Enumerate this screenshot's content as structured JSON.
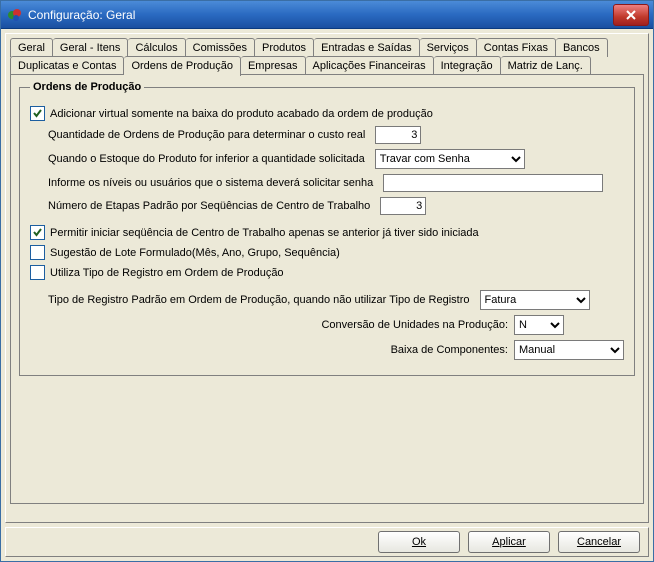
{
  "window": {
    "title": "Configuração: Geral"
  },
  "tabs": {
    "row1": [
      "Geral",
      "Geral - Itens",
      "Cálculos",
      "Comissões",
      "Produtos",
      "Entradas e Saídas",
      "Serviços",
      "Contas Fixas",
      "Bancos"
    ],
    "row2": [
      "Duplicatas e Contas",
      "Ordens de Produção",
      "Empresas",
      "Aplicações Financeiras",
      "Integração",
      "Matriz de Lanç."
    ],
    "active": "Ordens de Produção"
  },
  "group": {
    "legend": "Ordens de Produção",
    "chk_add_virtual": "Adicionar virtual somente na baixa do produto acabado da ordem de produção",
    "qtd_label": "Quantidade de Ordens de Produção para determinar o custo real",
    "qtd_value": "3",
    "estoque_label": "Quando o Estoque do Produto for inferior a quantidade solicitada",
    "estoque_value": "Travar com Senha",
    "niveis_label": "Informe os níveis ou usuários que o sistema deverá solicitar senha",
    "niveis_value": "",
    "etapas_label": "Número de Etapas Padrão por Seqüências de Centro de Trabalho",
    "etapas_value": "3",
    "chk_permit": "Permitir iniciar seqüência de Centro de Trabalho apenas se anterior já tiver sido iniciada",
    "chk_sugestao": "Sugestão de Lote Formulado(Mês, Ano, Grupo, Sequência)",
    "chk_utiliza": "Utiliza Tipo de Registro em Ordem de Produção",
    "tipo_label": "Tipo de Registro Padrão em Ordem de Produção, quando não utilizar Tipo de Registro",
    "tipo_value": "Fatura",
    "conv_label": "Conversão de Unidades na Produção:",
    "conv_value": "N",
    "baixa_label": "Baixa de Componentes:",
    "baixa_value": "Manual"
  },
  "buttons": {
    "ok": "Ok",
    "apply": "Aplicar",
    "cancel": "Cancelar"
  }
}
